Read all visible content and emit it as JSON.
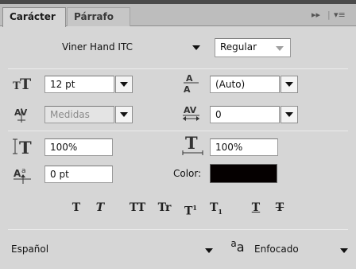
{
  "panel": {
    "tabs": [
      {
        "label": "Carácter",
        "active": true
      },
      {
        "label": "Párrafo",
        "active": false
      }
    ],
    "controls": {
      "expand": "▸▸",
      "menu": "▾≡"
    }
  },
  "font": {
    "family": "Viner Hand ITC",
    "style": "Regular"
  },
  "size": {
    "font_size": "12 pt",
    "leading": "(Auto)"
  },
  "spacing": {
    "kerning": "Medidas",
    "tracking": "0"
  },
  "scale": {
    "vertical": "100%",
    "horizontal": "100%"
  },
  "baseline": {
    "shift": "0 pt",
    "color_label": "Color:",
    "color_value": "#050000"
  },
  "styles": {
    "bold": "T",
    "italic": "T",
    "all_caps": "TT",
    "small_caps": "Tr",
    "superscript": "T",
    "superscript_mark": "1",
    "subscript": "T",
    "subscript_mark": "1",
    "underline": "T",
    "strikethrough": "T"
  },
  "language": {
    "value": "Español"
  },
  "antialias": {
    "icon_text": "a",
    "icon_text_big": "a",
    "value": "Enfocado"
  }
}
